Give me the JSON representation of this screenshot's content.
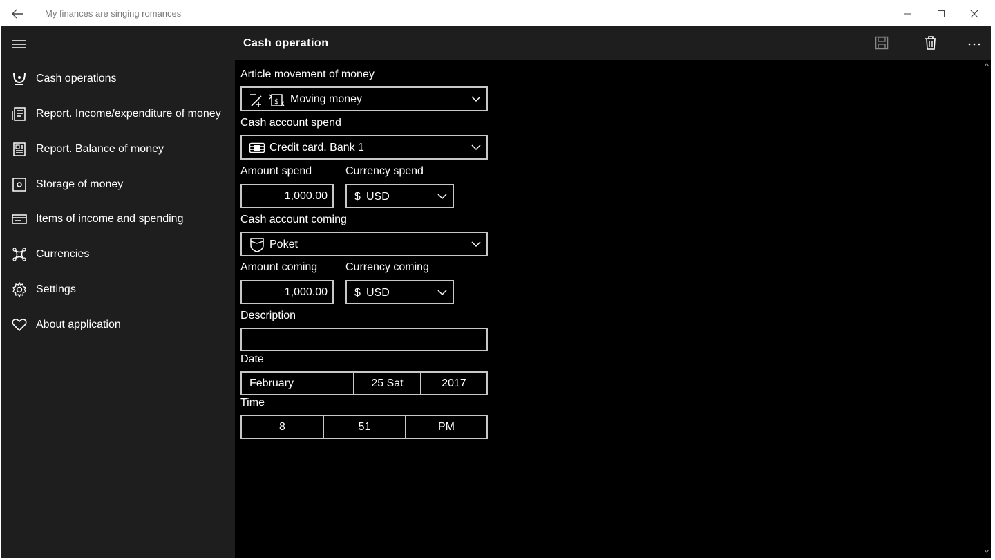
{
  "window": {
    "title": "My finances are singing romances"
  },
  "sidebar": {
    "items": [
      {
        "label": "Cash operations",
        "icon": "cash-operations-icon"
      },
      {
        "label": "Report. Income/expenditure of money",
        "icon": "report-icon"
      },
      {
        "label": "Report. Balance of money",
        "icon": "balance-report-icon"
      },
      {
        "label": "Storage of money",
        "icon": "safe-icon"
      },
      {
        "label": "Items of income and spending",
        "icon": "items-icon"
      },
      {
        "label": "Currencies",
        "icon": "currency-icon"
      },
      {
        "label": "Settings",
        "icon": "gear-icon"
      },
      {
        "label": "About application",
        "icon": "heart-icon"
      }
    ]
  },
  "header": {
    "title": "Cash operation",
    "more_label": "···"
  },
  "form": {
    "article_label": "Article movement of money",
    "article_value": "Moving money",
    "spend_account_label": "Cash account spend",
    "spend_account_value": "Credit card. Bank 1",
    "amount_spend_label": "Amount spend",
    "amount_spend_value": "1,000.00",
    "currency_spend_label": "Currency spend",
    "currency_spend_symbol": "$",
    "currency_spend_value": "USD",
    "coming_account_label": "Cash account coming",
    "coming_account_value": "Poket",
    "amount_coming_label": "Amount coming",
    "amount_coming_value": "1,000.00",
    "currency_coming_label": "Currency coming",
    "currency_coming_symbol": "$",
    "currency_coming_value": "USD",
    "description_label": "Description",
    "description_value": "",
    "date_label": "Date",
    "date_month": "February",
    "date_day": "25  Sat",
    "date_year": "2017",
    "time_label": "Time",
    "time_hour": "8",
    "time_minute": "51",
    "time_period": "PM"
  },
  "colors": {
    "background": "#000000",
    "sidebar": "#1e1e1e",
    "border": "#c8c8c8",
    "text": "#ffffff"
  }
}
